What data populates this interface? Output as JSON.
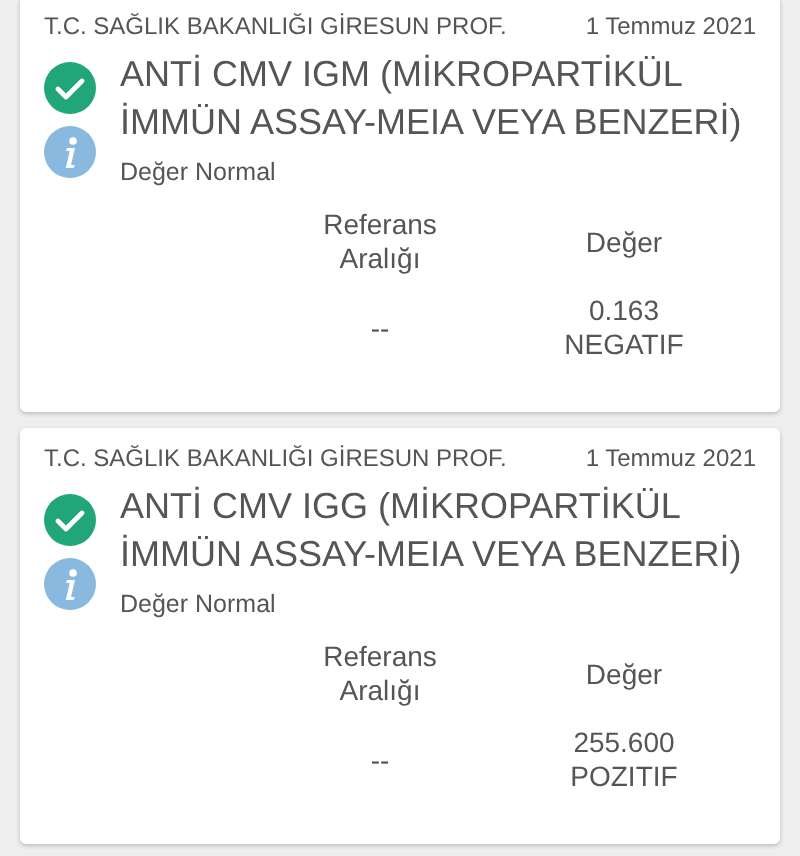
{
  "results": [
    {
      "source": "T.C. SAĞLIK BAKANLIĞI GİRESUN PROF.",
      "date": "1 Temmuz 2021",
      "verified": true,
      "title": "ANTİ CMV IGM (MİKROPARTİKÜL İMMÜN ASSAY-MEIA VEYA BENZERİ)",
      "status": "Değer Normal",
      "columns": [
        "Referans Aralığı",
        "Değer"
      ],
      "reference": "--",
      "value": "0.163\nNEGATIF"
    },
    {
      "source": "T.C. SAĞLIK BAKANLIĞI GİRESUN PROF.",
      "date": "1 Temmuz 2021",
      "verified": true,
      "title": "ANTİ CMV IGG (MİKROPARTİKÜL İMMÜN ASSAY-MEIA VEYA BENZERİ)",
      "status": "Değer Normal",
      "columns": [
        "Referans Aralığı",
        "Değer"
      ],
      "reference": "--",
      "value": "255.600\nPOZITIF"
    }
  ]
}
